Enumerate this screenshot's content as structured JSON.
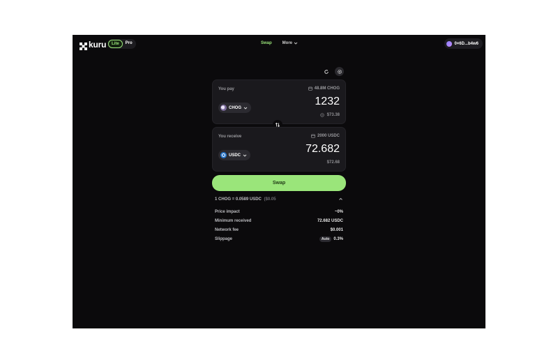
{
  "header": {
    "logo_text": "kuru",
    "mode_lite": "Lite",
    "mode_pro": "Pro",
    "nav_swap": "Swap",
    "nav_more": "More",
    "wallet_address": "0×6D...b4w6"
  },
  "pay": {
    "label": "You pay",
    "balance": "48.8M CHOG",
    "token": "CHOG",
    "amount": "1232",
    "usd": "$73.38"
  },
  "receive": {
    "label": "You receive",
    "balance": "2000 USDC",
    "token": "USDC",
    "amount": "72.682",
    "usd": "$72.68"
  },
  "swap_button": "Swap",
  "rate": {
    "text": "1 CHOG = 0.0589 USDC",
    "usd": "($0.05"
  },
  "details": [
    {
      "key": "Price impact",
      "value": "~0%"
    },
    {
      "key": "Minimum received",
      "value": "72.682 USDC"
    },
    {
      "key": "Network fee",
      "value": "$0.001"
    },
    {
      "key": "Slippage",
      "badge": "Auto",
      "value": "0.3%"
    }
  ],
  "colors": {
    "accent": "#9ae57a",
    "background": "#0b0a0c",
    "card": "#1a191d"
  }
}
